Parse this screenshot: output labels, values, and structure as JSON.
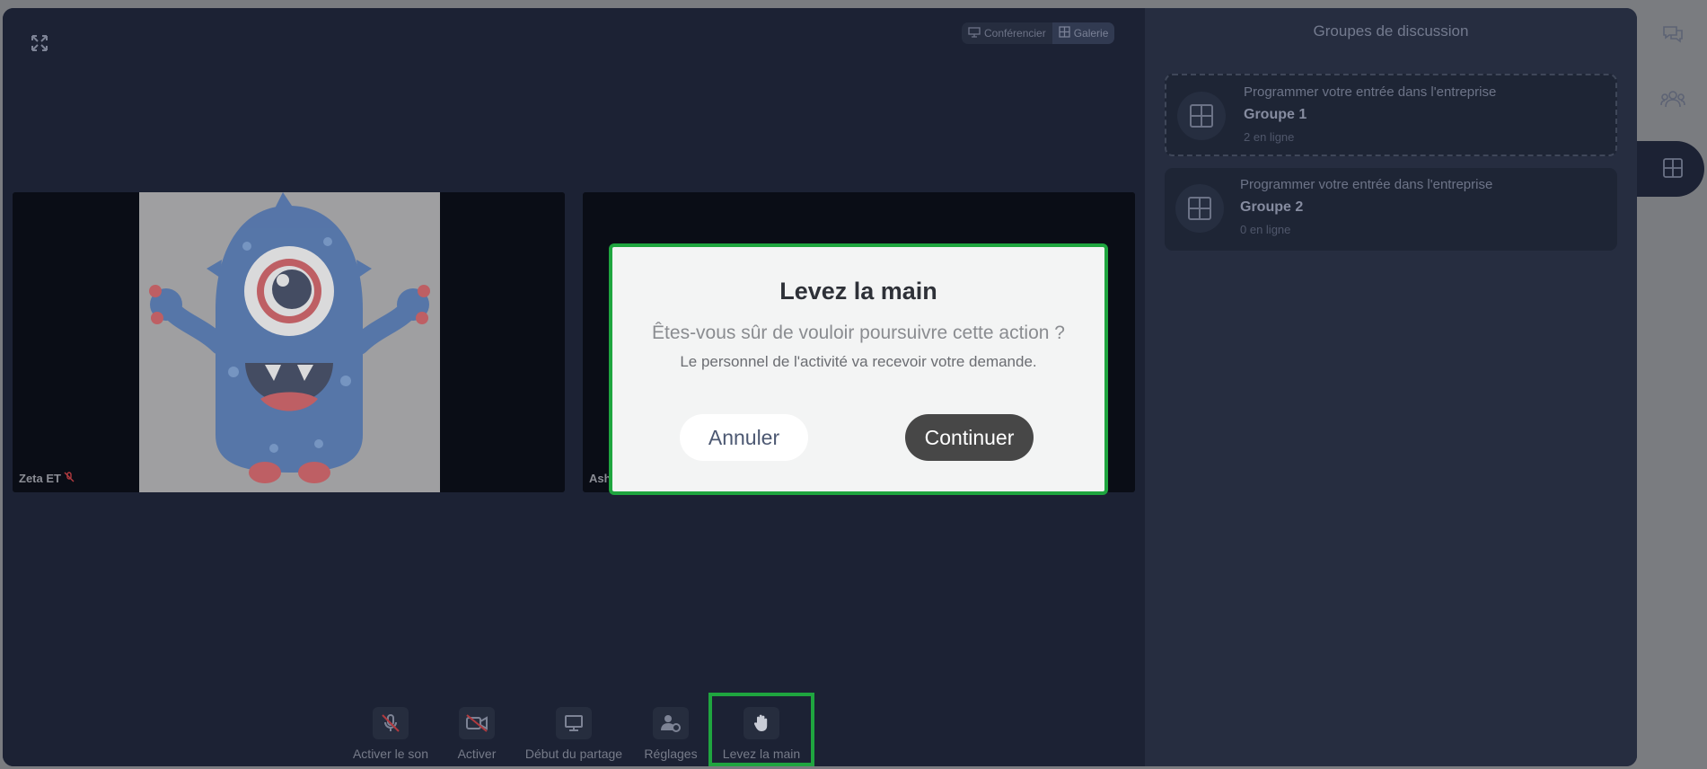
{
  "view_toggle": {
    "conference": "Conférencier",
    "gallery": "Galerie"
  },
  "participants": [
    {
      "name": "Zeta ET",
      "muted": true
    },
    {
      "name": "Ash",
      "muted": false
    }
  ],
  "controls": {
    "unmute": "Activer le son",
    "camera": "Activer",
    "share": "Début du partage",
    "settings": "Réglages",
    "raise_hand": "Levez la main"
  },
  "sidebar": {
    "title": "Groupes de discussion",
    "groups": [
      {
        "subtitle": "Programmer votre entrée dans l'entreprise",
        "name": "Groupe 1",
        "online": "2 en ligne"
      },
      {
        "subtitle": "Programmer votre entrée dans l'entreprise",
        "name": "Groupe 2",
        "online": "0 en ligne"
      }
    ]
  },
  "modal": {
    "title": "Levez la main",
    "question": "Êtes-vous sûr de vouloir poursuivre cette action ?",
    "note": "Le personnel de l'activité va recevoir votre demande.",
    "cancel": "Annuler",
    "continue": "Continuer"
  },
  "colors": {
    "highlight": "#1fa53f",
    "background": "#1c2234",
    "sidebar": "#262d40"
  },
  "icons": [
    "fullscreen-icon",
    "presenter-icon",
    "gallery-icon",
    "mic-off-icon",
    "camera-off-icon",
    "screen-share-icon",
    "settings-icon",
    "hand-icon",
    "grid-icon",
    "chat-icon",
    "people-icon"
  ]
}
